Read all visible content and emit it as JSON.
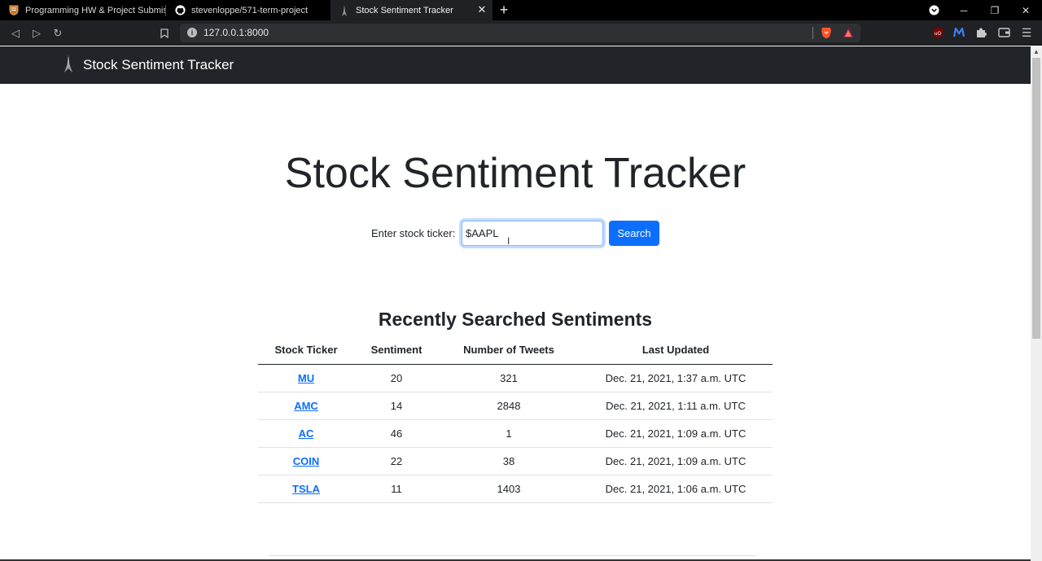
{
  "browser": {
    "tabs": [
      {
        "title": "Programming HW & Project Submissi"
      },
      {
        "title": "stevenloppe/571-term-project"
      },
      {
        "title": "Stock Sentiment Tracker",
        "active": true
      }
    ],
    "url": "127.0.0.1:8000"
  },
  "navbar": {
    "brand": "Stock Sentiment Tracker"
  },
  "hero": {
    "title": "Stock Sentiment Tracker"
  },
  "search": {
    "label": "Enter stock ticker:",
    "value": "$AAPL",
    "button": "Search"
  },
  "recent": {
    "title": "Recently Searched Sentiments",
    "columns": [
      "Stock Ticker",
      "Sentiment",
      "Number of Tweets",
      "Last Updated"
    ],
    "rows": [
      {
        "ticker": "MU",
        "sentiment": "20",
        "tweets": "321",
        "updated": "Dec. 21, 2021, 1:37 a.m. UTC"
      },
      {
        "ticker": "AMC",
        "sentiment": "14",
        "tweets": "2848",
        "updated": "Dec. 21, 2021, 1:11 a.m. UTC"
      },
      {
        "ticker": "AC",
        "sentiment": "46",
        "tweets": "1",
        "updated": "Dec. 21, 2021, 1:09 a.m. UTC"
      },
      {
        "ticker": "COIN",
        "sentiment": "22",
        "tweets": "38",
        "updated": "Dec. 21, 2021, 1:09 a.m. UTC"
      },
      {
        "ticker": "TSLA",
        "sentiment": "11",
        "tweets": "1403",
        "updated": "Dec. 21, 2021, 1:06 a.m. UTC"
      }
    ]
  },
  "colors": {
    "primary": "#0d6efd",
    "navbar": "#212529",
    "chrome": "#202124"
  }
}
